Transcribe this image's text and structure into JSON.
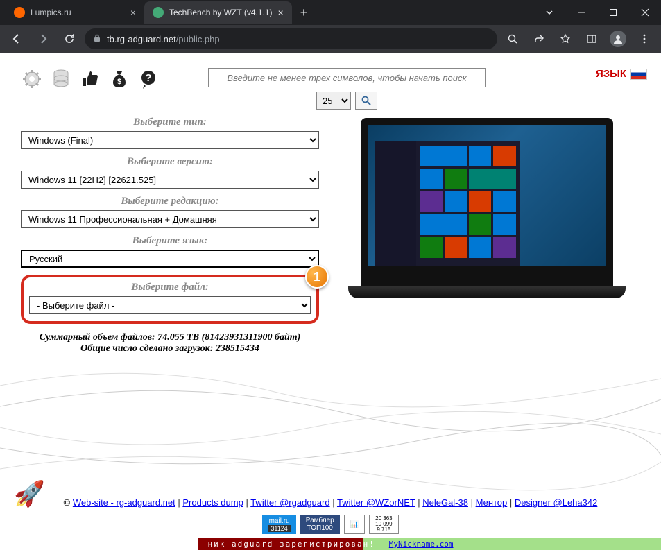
{
  "browser": {
    "tabs": [
      {
        "title": "Lumpics.ru",
        "active": false
      },
      {
        "title": "TechBench by WZT (v4.1.1)",
        "active": true
      }
    ],
    "url_host": "tb.rg-adguard.net",
    "url_path": "/public.php"
  },
  "search": {
    "placeholder": "Введите не менее трех символов, чтобы начать поиск",
    "page_size": "25"
  },
  "language": {
    "label": "ЯЗЫК"
  },
  "form": {
    "type": {
      "label": "Выберите тип:",
      "value": "Windows (Final)"
    },
    "version": {
      "label": "Выберите версию:",
      "value": "Windows 11 [22H2] [22621.525]"
    },
    "edition": {
      "label": "Выберите редакцию:",
      "value": "Windows 11 Профессиональная + Домашняя"
    },
    "lang": {
      "label": "Выберите язык:",
      "value": "Русский"
    },
    "file": {
      "label": "Выберите файл:",
      "value": "- Выберите файл -"
    }
  },
  "marker": "1",
  "stats": {
    "size_line_prefix": "Суммарный объем файлов: 74.055 TB (81423931311900 байт)",
    "downloads_prefix": "Общие число сделано загрузок: ",
    "downloads_link": "238515434"
  },
  "footer": {
    "links": [
      "Web-site - rg-adguard.net",
      "Products dump",
      "Twitter @rgadguard",
      "Twitter @WZorNET",
      "NeleGal-38",
      "Ментор",
      "Designer @Leha342"
    ],
    "mailru_top": "mail.ru",
    "mailru_bot": "31124",
    "rambler_top": "Рамблер",
    "rambler_bot": "ТОП100",
    "li_1": "20 363",
    "li_2": "10 099",
    "li_3": "9 715",
    "nick_red": "ник adguard зарегистрирован!",
    "nick_link": "MyNickname.com"
  }
}
